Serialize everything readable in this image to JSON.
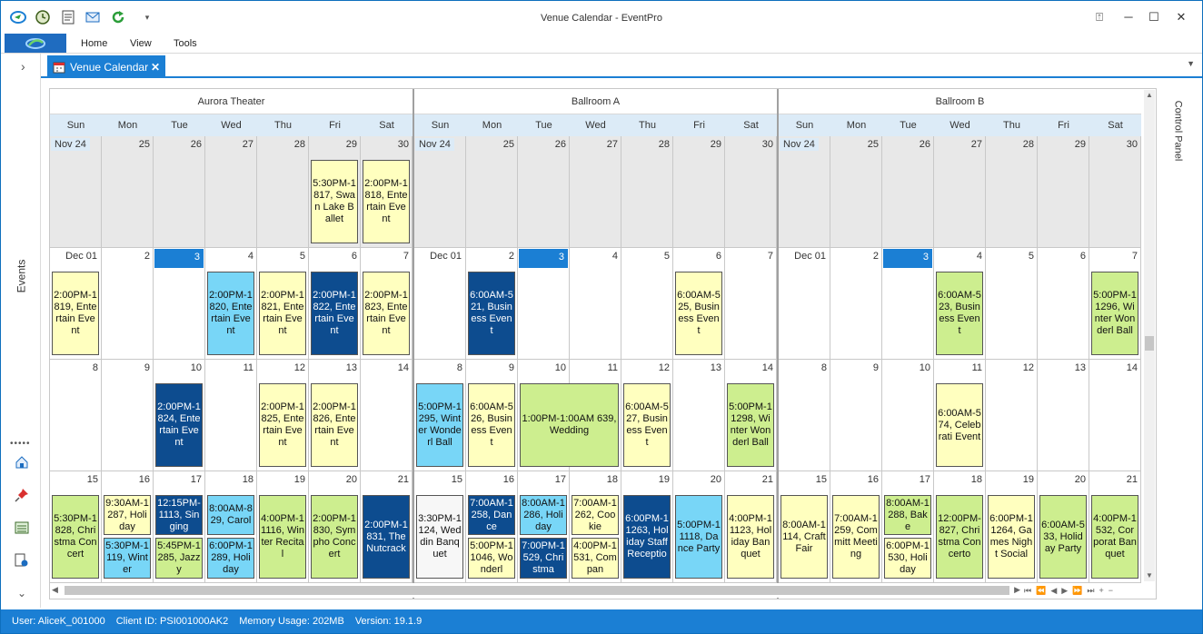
{
  "window": {
    "title": "Venue Calendar - EventPro"
  },
  "quick_access": [
    {
      "icon": "eventpro-logo-icon"
    },
    {
      "icon": "clock-icon"
    },
    {
      "icon": "document-icon"
    },
    {
      "icon": "mail-icon"
    },
    {
      "icon": "refresh-icon"
    },
    {
      "icon": "customize-dropdown-icon",
      "glyph": "▾"
    }
  ],
  "window_controls": {
    "restore_ribbon": "⍐",
    "minimize": "─",
    "maximize": "☐",
    "close": "✕"
  },
  "ribbon": {
    "tabs": [
      "Home",
      "View",
      "Tools"
    ]
  },
  "doc_tab": {
    "label": "Venue Calendar",
    "close": "✕"
  },
  "left_sidebar": {
    "expand_glyph": "›",
    "label": "Events",
    "grip": "•••••",
    "icons": [
      "home-icon",
      "pin-icon",
      "list-icon",
      "document-settings-icon"
    ],
    "collapse_glyph": "⌄"
  },
  "right_sidebar": {
    "label": "Control Panel"
  },
  "colors": {
    "yellow": "#ffffbf",
    "green": "#cdee8f",
    "cyan": "#78d6f7",
    "navy": "#0d4c8f",
    "white": "#f7f7f7",
    "accent": "#1b7fd4"
  },
  "venues": [
    {
      "name": "Aurora Theater",
      "weeks": [
        [
          "Nov 24",
          "25",
          "26",
          "27",
          "28",
          "29",
          "30"
        ],
        [
          "Dec 01",
          "2",
          "3",
          "4",
          "5",
          "6",
          "7"
        ],
        [
          "8",
          "9",
          "10",
          "11",
          "12",
          "13",
          "14"
        ],
        [
          "15",
          "16",
          "17",
          "18",
          "19",
          "20",
          "21"
        ]
      ]
    },
    {
      "name": "Ballroom A",
      "weeks": [
        [
          "Nov 24",
          "25",
          "26",
          "27",
          "28",
          "29",
          "30"
        ],
        [
          "Dec 01",
          "2",
          "3",
          "4",
          "5",
          "6",
          "7"
        ],
        [
          "8",
          "9",
          "10",
          "11",
          "12",
          "13",
          "14"
        ],
        [
          "15",
          "16",
          "17",
          "18",
          "19",
          "20",
          "21"
        ]
      ]
    },
    {
      "name": "Ballroom B",
      "weeks": [
        [
          "Nov 24",
          "25",
          "26",
          "27",
          "28",
          "29",
          "30"
        ],
        [
          "Dec 01",
          "2",
          "3",
          "4",
          "5",
          "6",
          "7"
        ],
        [
          "8",
          "9",
          "10",
          "11",
          "12",
          "13",
          "14"
        ],
        [
          "15",
          "16",
          "17",
          "18",
          "19",
          "20",
          "21"
        ]
      ]
    }
  ],
  "weekdays": [
    "Sun",
    "Mon",
    "Tue",
    "Wed",
    "Thu",
    "Fri",
    "Sat"
  ],
  "appointments": [
    {
      "v": 0,
      "w": 0,
      "d": 5,
      "span": 1,
      "slot": "full",
      "color": "yellow",
      "text": "5:30PM-1817, Swan Lake Ballet"
    },
    {
      "v": 0,
      "w": 0,
      "d": 6,
      "span": 1,
      "slot": "full",
      "color": "yellow",
      "text": "2:00PM-1818, Entertain Event"
    },
    {
      "v": 0,
      "w": 1,
      "d": 0,
      "span": 1,
      "slot": "full",
      "color": "yellow",
      "text": "2:00PM-1819, Entertain Event"
    },
    {
      "v": 0,
      "w": 1,
      "d": 3,
      "span": 1,
      "slot": "full",
      "color": "cyan",
      "text": "2:00PM-1820, Entertain Event"
    },
    {
      "v": 0,
      "w": 1,
      "d": 4,
      "span": 1,
      "slot": "full",
      "color": "yellow",
      "text": "2:00PM-1821, Entertain Event"
    },
    {
      "v": 0,
      "w": 1,
      "d": 5,
      "span": 1,
      "slot": "full",
      "color": "navy",
      "text": "2:00PM-1822, Entertain Event"
    },
    {
      "v": 0,
      "w": 1,
      "d": 6,
      "span": 1,
      "slot": "full",
      "color": "yellow",
      "text": "2:00PM-1823, Entertain Event"
    },
    {
      "v": 0,
      "w": 2,
      "d": 2,
      "span": 1,
      "slot": "full",
      "color": "navy",
      "text": "2:00PM-1824, Entertain Event"
    },
    {
      "v": 0,
      "w": 2,
      "d": 4,
      "span": 1,
      "slot": "full",
      "color": "yellow",
      "text": "2:00PM-1825, Entertain Event"
    },
    {
      "v": 0,
      "w": 2,
      "d": 5,
      "span": 1,
      "slot": "full",
      "color": "yellow",
      "text": "2:00PM-1826, Entertain Event"
    },
    {
      "v": 0,
      "w": 3,
      "d": 0,
      "span": 1,
      "slot": "full",
      "color": "green",
      "text": "5:30PM-1828, Christma Concert"
    },
    {
      "v": 0,
      "w": 3,
      "d": 1,
      "span": 1,
      "slot": "top",
      "color": "yellow",
      "text": "9:30AM-1287, Holiday"
    },
    {
      "v": 0,
      "w": 3,
      "d": 1,
      "span": 1,
      "slot": "bottom",
      "color": "cyan",
      "text": "5:30PM-1119, Winter"
    },
    {
      "v": 0,
      "w": 3,
      "d": 2,
      "span": 1,
      "slot": "top",
      "color": "navy",
      "text": "12:15PM-1113, Singing"
    },
    {
      "v": 0,
      "w": 3,
      "d": 2,
      "span": 1,
      "slot": "bottom",
      "color": "green",
      "text": "5:45PM-1285, Jazzy"
    },
    {
      "v": 0,
      "w": 3,
      "d": 3,
      "span": 1,
      "slot": "top",
      "color": "cyan",
      "text": "8:00AM-829, Carol"
    },
    {
      "v": 0,
      "w": 3,
      "d": 3,
      "span": 1,
      "slot": "bottom",
      "color": "cyan",
      "text": "6:00PM-1289, Holiday"
    },
    {
      "v": 0,
      "w": 3,
      "d": 4,
      "span": 1,
      "slot": "full",
      "color": "green",
      "text": "4:00PM-11116, Winter Recital"
    },
    {
      "v": 0,
      "w": 3,
      "d": 5,
      "span": 1,
      "slot": "full",
      "color": "green",
      "text": "2:00PM-1830, Sympho Concert"
    },
    {
      "v": 0,
      "w": 3,
      "d": 6,
      "span": 1,
      "slot": "full",
      "color": "navy",
      "text": "2:00PM-1831, The Nutcrack"
    },
    {
      "v": 1,
      "w": 1,
      "d": 1,
      "span": 1,
      "slot": "full",
      "color": "navy",
      "text": "6:00AM-521, Business Event"
    },
    {
      "v": 1,
      "w": 1,
      "d": 5,
      "span": 1,
      "slot": "full",
      "color": "yellow",
      "text": "6:00AM-525, Business Event"
    },
    {
      "v": 1,
      "w": 2,
      "d": 0,
      "span": 1,
      "slot": "full",
      "color": "cyan",
      "text": "5:00PM-1295, Winter Wonderl Ball"
    },
    {
      "v": 1,
      "w": 2,
      "d": 1,
      "span": 1,
      "slot": "full",
      "color": "yellow",
      "text": "6:00AM-526, Business Event"
    },
    {
      "v": 1,
      "w": 2,
      "d": 2,
      "span": 2,
      "slot": "full",
      "color": "green",
      "text": "1:00PM-1:00AM 639, Wedding"
    },
    {
      "v": 1,
      "w": 2,
      "d": 4,
      "span": 1,
      "slot": "full",
      "color": "yellow",
      "text": "6:00AM-527, Business Event"
    },
    {
      "v": 1,
      "w": 2,
      "d": 6,
      "span": 1,
      "slot": "full",
      "color": "green",
      "text": "5:00PM-11298, Winter Wonderl Ball"
    },
    {
      "v": 1,
      "w": 3,
      "d": 0,
      "span": 1,
      "slot": "full",
      "color": "white",
      "text": "3:30PM-1124, Weddin Banquet"
    },
    {
      "v": 1,
      "w": 3,
      "d": 1,
      "span": 1,
      "slot": "top",
      "color": "navy",
      "text": "7:00AM-1258, Dance"
    },
    {
      "v": 1,
      "w": 3,
      "d": 1,
      "span": 1,
      "slot": "bottom",
      "color": "yellow",
      "text": "5:00PM-11046, Wonderl"
    },
    {
      "v": 1,
      "w": 3,
      "d": 2,
      "span": 1,
      "slot": "top",
      "color": "cyan",
      "text": "8:00AM-1286, Holiday"
    },
    {
      "v": 1,
      "w": 3,
      "d": 2,
      "span": 1,
      "slot": "bottom",
      "color": "navy",
      "text": "7:00PM-1529, Christma"
    },
    {
      "v": 1,
      "w": 3,
      "d": 3,
      "span": 1,
      "slot": "top",
      "color": "yellow",
      "text": "7:00AM-1262, Cookie"
    },
    {
      "v": 1,
      "w": 3,
      "d": 3,
      "span": 1,
      "slot": "bottom",
      "color": "yellow",
      "text": "4:00PM-1531, Compan"
    },
    {
      "v": 1,
      "w": 3,
      "d": 4,
      "span": 1,
      "slot": "full",
      "color": "navy",
      "text": "6:00PM-11263, Holiday Staff Receptio"
    },
    {
      "v": 1,
      "w": 3,
      "d": 5,
      "span": 1,
      "slot": "full",
      "color": "cyan",
      "text": "5:00PM-11118, Dance Party"
    },
    {
      "v": 1,
      "w": 3,
      "d": 6,
      "span": 1,
      "slot": "full",
      "color": "yellow",
      "text": "4:00PM-11123, Holiday Banquet"
    },
    {
      "v": 2,
      "w": 1,
      "d": 3,
      "span": 1,
      "slot": "full",
      "color": "green",
      "text": "6:00AM-523, Business Event"
    },
    {
      "v": 2,
      "w": 1,
      "d": 6,
      "span": 1,
      "slot": "full",
      "color": "green",
      "text": "5:00PM-11296, Winter Wonderl Ball"
    },
    {
      "v": 2,
      "w": 2,
      "d": 3,
      "span": 1,
      "slot": "full",
      "color": "yellow",
      "text": "6:00AM-574, Celebrati Event"
    },
    {
      "v": 2,
      "w": 3,
      "d": 0,
      "span": 1,
      "slot": "full",
      "color": "yellow",
      "text": "8:00AM-1114, Craft Fair"
    },
    {
      "v": 2,
      "w": 3,
      "d": 1,
      "span": 1,
      "slot": "full",
      "color": "yellow",
      "text": "7:00AM-1259, Committ Meeting"
    },
    {
      "v": 2,
      "w": 3,
      "d": 2,
      "span": 1,
      "slot": "top",
      "color": "green",
      "text": "8:00AM-1288, Bake"
    },
    {
      "v": 2,
      "w": 3,
      "d": 2,
      "span": 1,
      "slot": "bottom",
      "color": "yellow",
      "text": "6:00PM-1530, Holiday"
    },
    {
      "v": 2,
      "w": 3,
      "d": 3,
      "span": 1,
      "slot": "full",
      "color": "green",
      "text": "12:00PM-827, Christma Concerto"
    },
    {
      "v": 2,
      "w": 3,
      "d": 4,
      "span": 1,
      "slot": "full",
      "color": "yellow",
      "text": "6:00PM-11264, Games Night Social"
    },
    {
      "v": 2,
      "w": 3,
      "d": 5,
      "span": 1,
      "slot": "full",
      "color": "green",
      "text": "6:00AM-533, Holiday Party"
    },
    {
      "v": 2,
      "w": 3,
      "d": 6,
      "span": 1,
      "slot": "full",
      "color": "green",
      "text": "4:00PM-1532, Corporat Banquet"
    }
  ],
  "status": {
    "user": "User: AliceK_001000",
    "client": "Client ID: PSI001000AK2",
    "memory": "Memory Usage: 202MB",
    "version": "Version: 19.1.9"
  },
  "nav_buttons": [
    "⏮",
    "⏪",
    "◀",
    "▶",
    "⏩",
    "⏭",
    "+",
    "−"
  ]
}
